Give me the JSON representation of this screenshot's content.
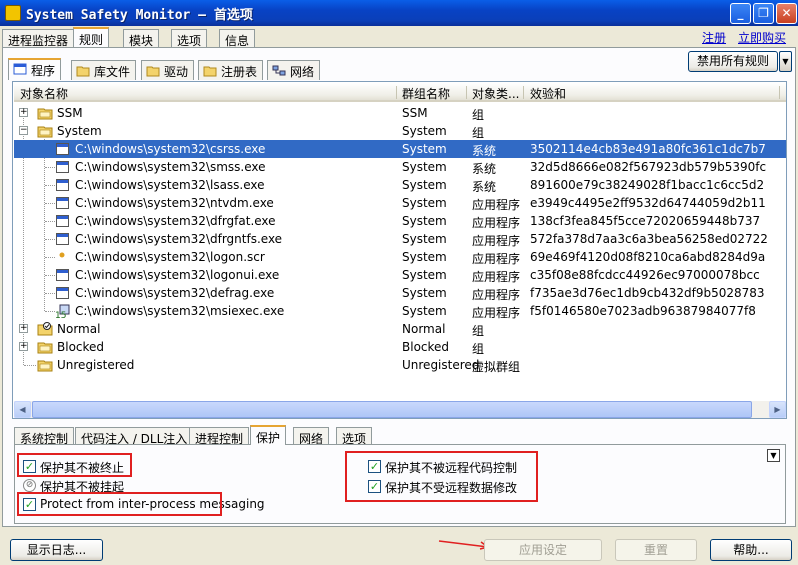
{
  "window": {
    "title": "System Safety Monitor — 首选项",
    "minimize": "_",
    "restore": "❐",
    "close": "✕"
  },
  "main_tabs": [
    {
      "label": "进程监控器"
    },
    {
      "label": "规则"
    },
    {
      "label": "模块"
    },
    {
      "label": "选项"
    },
    {
      "label": "信息"
    }
  ],
  "links": {
    "register": "注册",
    "buy": "立即购买"
  },
  "sub_tabs": [
    {
      "label": "程序"
    },
    {
      "label": "库文件"
    },
    {
      "label": "驱动"
    },
    {
      "label": "注册表"
    },
    {
      "label": "网络"
    }
  ],
  "disable_all_label": "禁用所有规则",
  "columns": [
    "对象名称",
    "群组名称",
    "对象类...",
    "效验和"
  ],
  "rows": [
    {
      "name": "SSM",
      "group": "SSM",
      "type": "组",
      "checksum": ""
    },
    {
      "name": "System",
      "group": "System",
      "type": "组",
      "checksum": ""
    },
    {
      "name": "C:\\windows\\system32\\csrss.exe",
      "group": "System",
      "type": "系统",
      "checksum": "3502114e4cb83e491a80fc361c1dc7b7"
    },
    {
      "name": "C:\\windows\\system32\\smss.exe",
      "group": "System",
      "type": "系统",
      "checksum": "32d5d8666e082f567923db579b5390fc"
    },
    {
      "name": "C:\\windows\\system32\\lsass.exe",
      "group": "System",
      "type": "系统",
      "checksum": "891600e79c38249028f1bacc1c6cc5d2"
    },
    {
      "name": "C:\\windows\\system32\\ntvdm.exe",
      "group": "System",
      "type": "应用程序",
      "checksum": "e3949c4495e2ff9532d64744059d2b11"
    },
    {
      "name": "C:\\windows\\system32\\dfrgfat.exe",
      "group": "System",
      "type": "应用程序",
      "checksum": "138cf3fea845f5cce72020659448b737"
    },
    {
      "name": "C:\\windows\\system32\\dfrgntfs.exe",
      "group": "System",
      "type": "应用程序",
      "checksum": "572fa378d7aa3c6a3bea56258ed02722"
    },
    {
      "name": "C:\\windows\\system32\\logon.scr",
      "group": "System",
      "type": "应用程序",
      "checksum": "69e469f4120d08f8210ca6abd8284d9a"
    },
    {
      "name": "C:\\windows\\system32\\logonui.exe",
      "group": "System",
      "type": "应用程序",
      "checksum": "c35f08e88fcdcc44926ec97000078bcc"
    },
    {
      "name": "C:\\windows\\system32\\defrag.exe",
      "group": "System",
      "type": "应用程序",
      "checksum": "f735ae3d76ec1db9cb432df9b5028783"
    },
    {
      "name": "C:\\windows\\system32\\msiexec.exe",
      "group": "System",
      "type": "应用程序",
      "checksum": "f5f0146580e7023adb96387984077f8"
    },
    {
      "name": "Normal",
      "group": "Normal",
      "type": "组",
      "checksum": ""
    },
    {
      "name": "Blocked",
      "group": "Blocked",
      "type": "组",
      "checksum": ""
    },
    {
      "name": "Unregistered",
      "group": "Unregistered",
      "type": "虚拟群组",
      "checksum": ""
    }
  ],
  "bottom_tabs": [
    {
      "label": "系统控制"
    },
    {
      "label": "代码注入 / DLL注入"
    },
    {
      "label": "进程控制"
    },
    {
      "label": "保护"
    },
    {
      "label": "网络"
    },
    {
      "label": "选项"
    }
  ],
  "options": {
    "protect_terminate": "保护其不被终止",
    "protect_suspend": "保护其不被挂起",
    "protect_messaging": "Protect from inter-process messaging",
    "protect_remote_code": "保护其不被远程代码控制",
    "protect_remote_data": "保护其不受远程数据修改"
  },
  "buttons": {
    "show_log": "显示日志...",
    "apply": "应用设定",
    "reset": "重置",
    "help": "帮助..."
  },
  "colors": {
    "selection": "#316ac5",
    "highlight_box": "#e02020",
    "active_tab_accent": "#e6a533"
  }
}
